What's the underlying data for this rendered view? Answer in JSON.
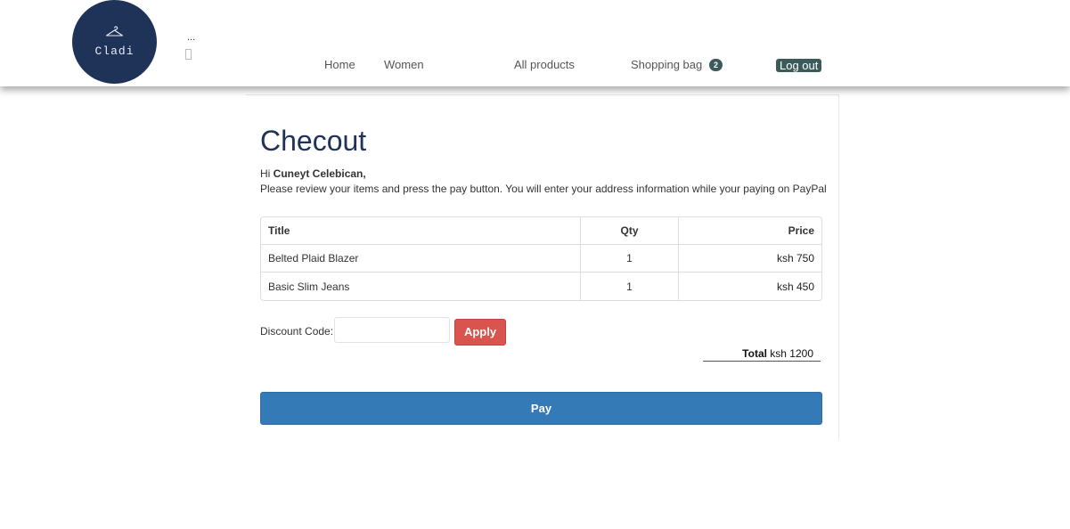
{
  "header": {
    "logo_text": "Cladi",
    "dots": "...",
    "nav": {
      "home": "Home",
      "women": "Women",
      "all_products": "All products",
      "shopping_bag": "Shopping bag",
      "bag_count": "2",
      "logout": "Log out"
    }
  },
  "checkout": {
    "title": "Checout",
    "greeting_prefix": "Hi ",
    "user_name": "Cuneyt Celebican,",
    "instruction": "Please review your items and press the pay button. You will enter your address information while your paying on PayPal",
    "table": {
      "headers": {
        "title": "Title",
        "qty": "Qty",
        "price": "Price"
      },
      "rows": [
        {
          "title": "Belted Plaid Blazer",
          "qty": "1",
          "price": "ksh 750"
        },
        {
          "title": "Basic Slim Jeans",
          "qty": "1",
          "price": "ksh 450"
        }
      ]
    },
    "discount": {
      "label": "Discount Code:",
      "value": "",
      "apply_label": "Apply"
    },
    "total": {
      "label": "Total",
      "value": "ksh 1200"
    },
    "pay_label": "Pay"
  },
  "colors": {
    "brand_navy": "#1f3257",
    "badge_teal": "#3d5a5a",
    "apply_red": "#d9534f",
    "pay_blue": "#337ab7"
  },
  "icons": {
    "logo": "hanger-icon"
  }
}
